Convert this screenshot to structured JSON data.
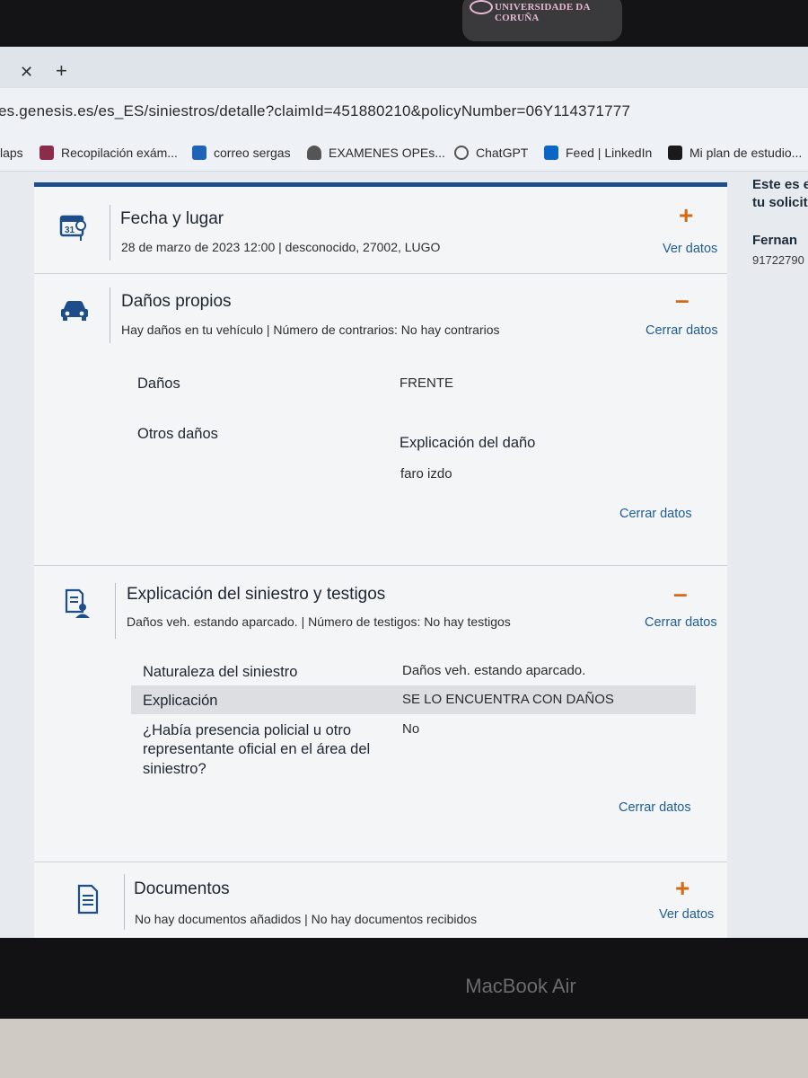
{
  "sticker": {
    "text": "UNIVERSIDADE DA CORUÑA"
  },
  "browser": {
    "url": "es.genesis.es/es_ES/siniestros/detalle?claimId=451880210&policyNumber=06Y114371777",
    "bookmarks": [
      {
        "label": "laps"
      },
      {
        "label": "Recopilación exám...",
        "icon": "notebook-icon",
        "color": "#8a2c4a"
      },
      {
        "label": "correo sergas",
        "icon": "outlook-icon",
        "color": "#1d63b8"
      },
      {
        "label": "EXAMENES OPEs...",
        "icon": "person-icon",
        "color": "#444444"
      },
      {
        "label": "ChatGPT",
        "icon": "chatgpt-icon",
        "color": "#555555"
      },
      {
        "label": "Feed | LinkedIn",
        "icon": "linkedin-icon",
        "color": "#0a66c2"
      },
      {
        "label": "Mi plan de estudio...",
        "icon": "g-icon",
        "color": "#1a1a1a"
      }
    ]
  },
  "right_panel": {
    "line1": "Este es e",
    "line2": "tu solicit",
    "name": "Fernan",
    "phone": "91722790"
  },
  "sections": {
    "fecha": {
      "title": "Fecha y lugar",
      "subtitle": "28 de marzo de 2023 12:00 | desconocido, 27002, LUGO",
      "toggle": "+",
      "link": "Ver datos",
      "icon": "calendar-icon"
    },
    "danos": {
      "title": "Daños propios",
      "subtitle": "Hay daños en tu vehículo | Número de contrarios: No hay contrarios",
      "toggle": "–",
      "link": "Cerrar datos",
      "icon": "car-icon",
      "rows": {
        "danos_label": "Daños",
        "danos_value": "FRENTE",
        "otros_label": "Otros daños",
        "explicacion_title": "Explicación del daño",
        "explicacion_value": "faro izdo"
      },
      "footer_link": "Cerrar datos"
    },
    "explicacion": {
      "title": "Explicación del siniestro y testigos",
      "subtitle": "Daños veh. estando aparcado. | Número de testigos: No hay testigos",
      "toggle": "–",
      "link": "Cerrar datos",
      "icon": "witness-icon",
      "rows": [
        {
          "label": "Naturaleza del siniestro",
          "value": "Daños veh. estando aparcado."
        },
        {
          "label": "Explicación",
          "value": "SE LO ENCUENTRA CON DAÑOS"
        },
        {
          "label_lines": [
            "¿Había presencia policial u otro",
            "representante oficial en el área del",
            "siniestro?"
          ],
          "value": "No"
        }
      ],
      "footer_link": "Cerrar datos"
    },
    "documentos": {
      "title": "Documentos",
      "subtitle": "No hay documentos añadidos | No hay documentos recibidos",
      "toggle": "+",
      "link": "Ver datos",
      "icon": "document-icon"
    }
  },
  "device": {
    "label": "MacBook Air"
  },
  "colors": {
    "accent": "#1d4e8a",
    "toggle": "#d36a17",
    "link": "#1f5c96"
  }
}
